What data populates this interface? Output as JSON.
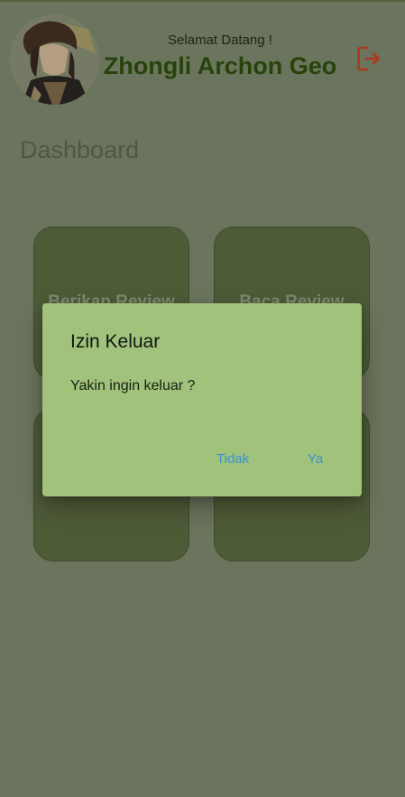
{
  "header": {
    "greeting": "Selamat Datang !",
    "username": "Zhongli Archon Geo",
    "logout_icon": "logout-icon"
  },
  "dashboard": {
    "title": "Dashboard",
    "cards": [
      {
        "label": "Berikan Review"
      },
      {
        "label": "Baca Review"
      },
      {
        "label": ""
      },
      {
        "label": ""
      }
    ]
  },
  "dialog": {
    "title": "Izin Keluar",
    "message": "Yakin ingin keluar ?",
    "cancel_label": "Tidak",
    "confirm_label": "Ya"
  },
  "colors": {
    "dim_background": "#6b745c",
    "card": "#4e5b37",
    "dialog": "#a0c27a",
    "username": "#27430b",
    "logout": "#a93a24",
    "dialog_button": "#3b92d6"
  }
}
